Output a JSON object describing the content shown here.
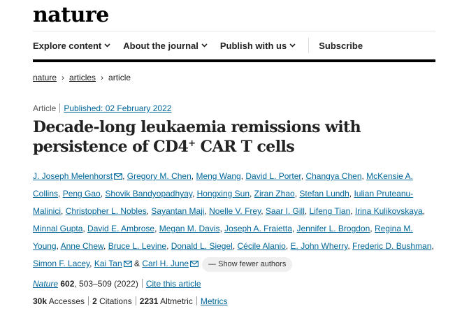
{
  "brand": {
    "logo": "nature"
  },
  "nav": {
    "items": [
      {
        "label": "Explore content",
        "dropdown": true
      },
      {
        "label": "About the journal",
        "dropdown": true
      },
      {
        "label": "Publish with us",
        "dropdown": true
      }
    ],
    "subscribe": "Subscribe"
  },
  "breadcrumb": {
    "items": [
      "nature",
      "articles",
      "article"
    ],
    "separator": "›"
  },
  "article": {
    "type": "Article",
    "published": "Published: 02 February 2022",
    "title_main": "Decade-long leukaemia remissions with persistence of CD4",
    "title_sup": "+",
    "title_end": " CAR T cells"
  },
  "authors": [
    "J. Joseph Melenhorst",
    "Gregory M. Chen",
    "Meng Wang",
    "David L. Porter",
    "Changya Chen",
    "McKensie A. Collins",
    "Peng Gao",
    "Shovik Bandyopadhyay",
    "Hongxing Sun",
    "Ziran Zhao",
    "Stefan Lundh",
    "Iulian Pruteanu-Malinici",
    "Christopher L. Nobles",
    "Sayantan Maji",
    "Noelle V. Frey",
    "Saar I. Gill",
    "Lifeng Tian",
    "Irina Kulikovskaya",
    "Minnal Gupta",
    "David E. Ambrose",
    "Megan M. Davis",
    "Joseph A. Fraietta",
    "Jennifer L. Brogdon",
    "Regina M. Young",
    "Anne Chew",
    "Bruce L. Levine",
    "Donald L. Siegel",
    "Cécile Alanio",
    "E. John Wherry",
    "Frederic D. Bushman",
    "Simon F. Lacey",
    "Kai Tan",
    "Carl H. June"
  ],
  "authors_ui": {
    "amp": "&",
    "fewer": "— Show fewer authors"
  },
  "citation": {
    "journal": "Nature",
    "volume": "602",
    "pages": ", 503–509 (2022)",
    "cite_link": "Cite this article"
  },
  "metrics": {
    "accesses_value": "30k",
    "accesses_label": " Accesses",
    "citations_value": "2",
    "citations_label": " Citations",
    "altmetric_value": "2231",
    "altmetric_label": " Altmetric",
    "metrics_link": "Metrics"
  },
  "colors": {
    "link": "#006699",
    "text": "#222222",
    "pill": "#efefef"
  }
}
